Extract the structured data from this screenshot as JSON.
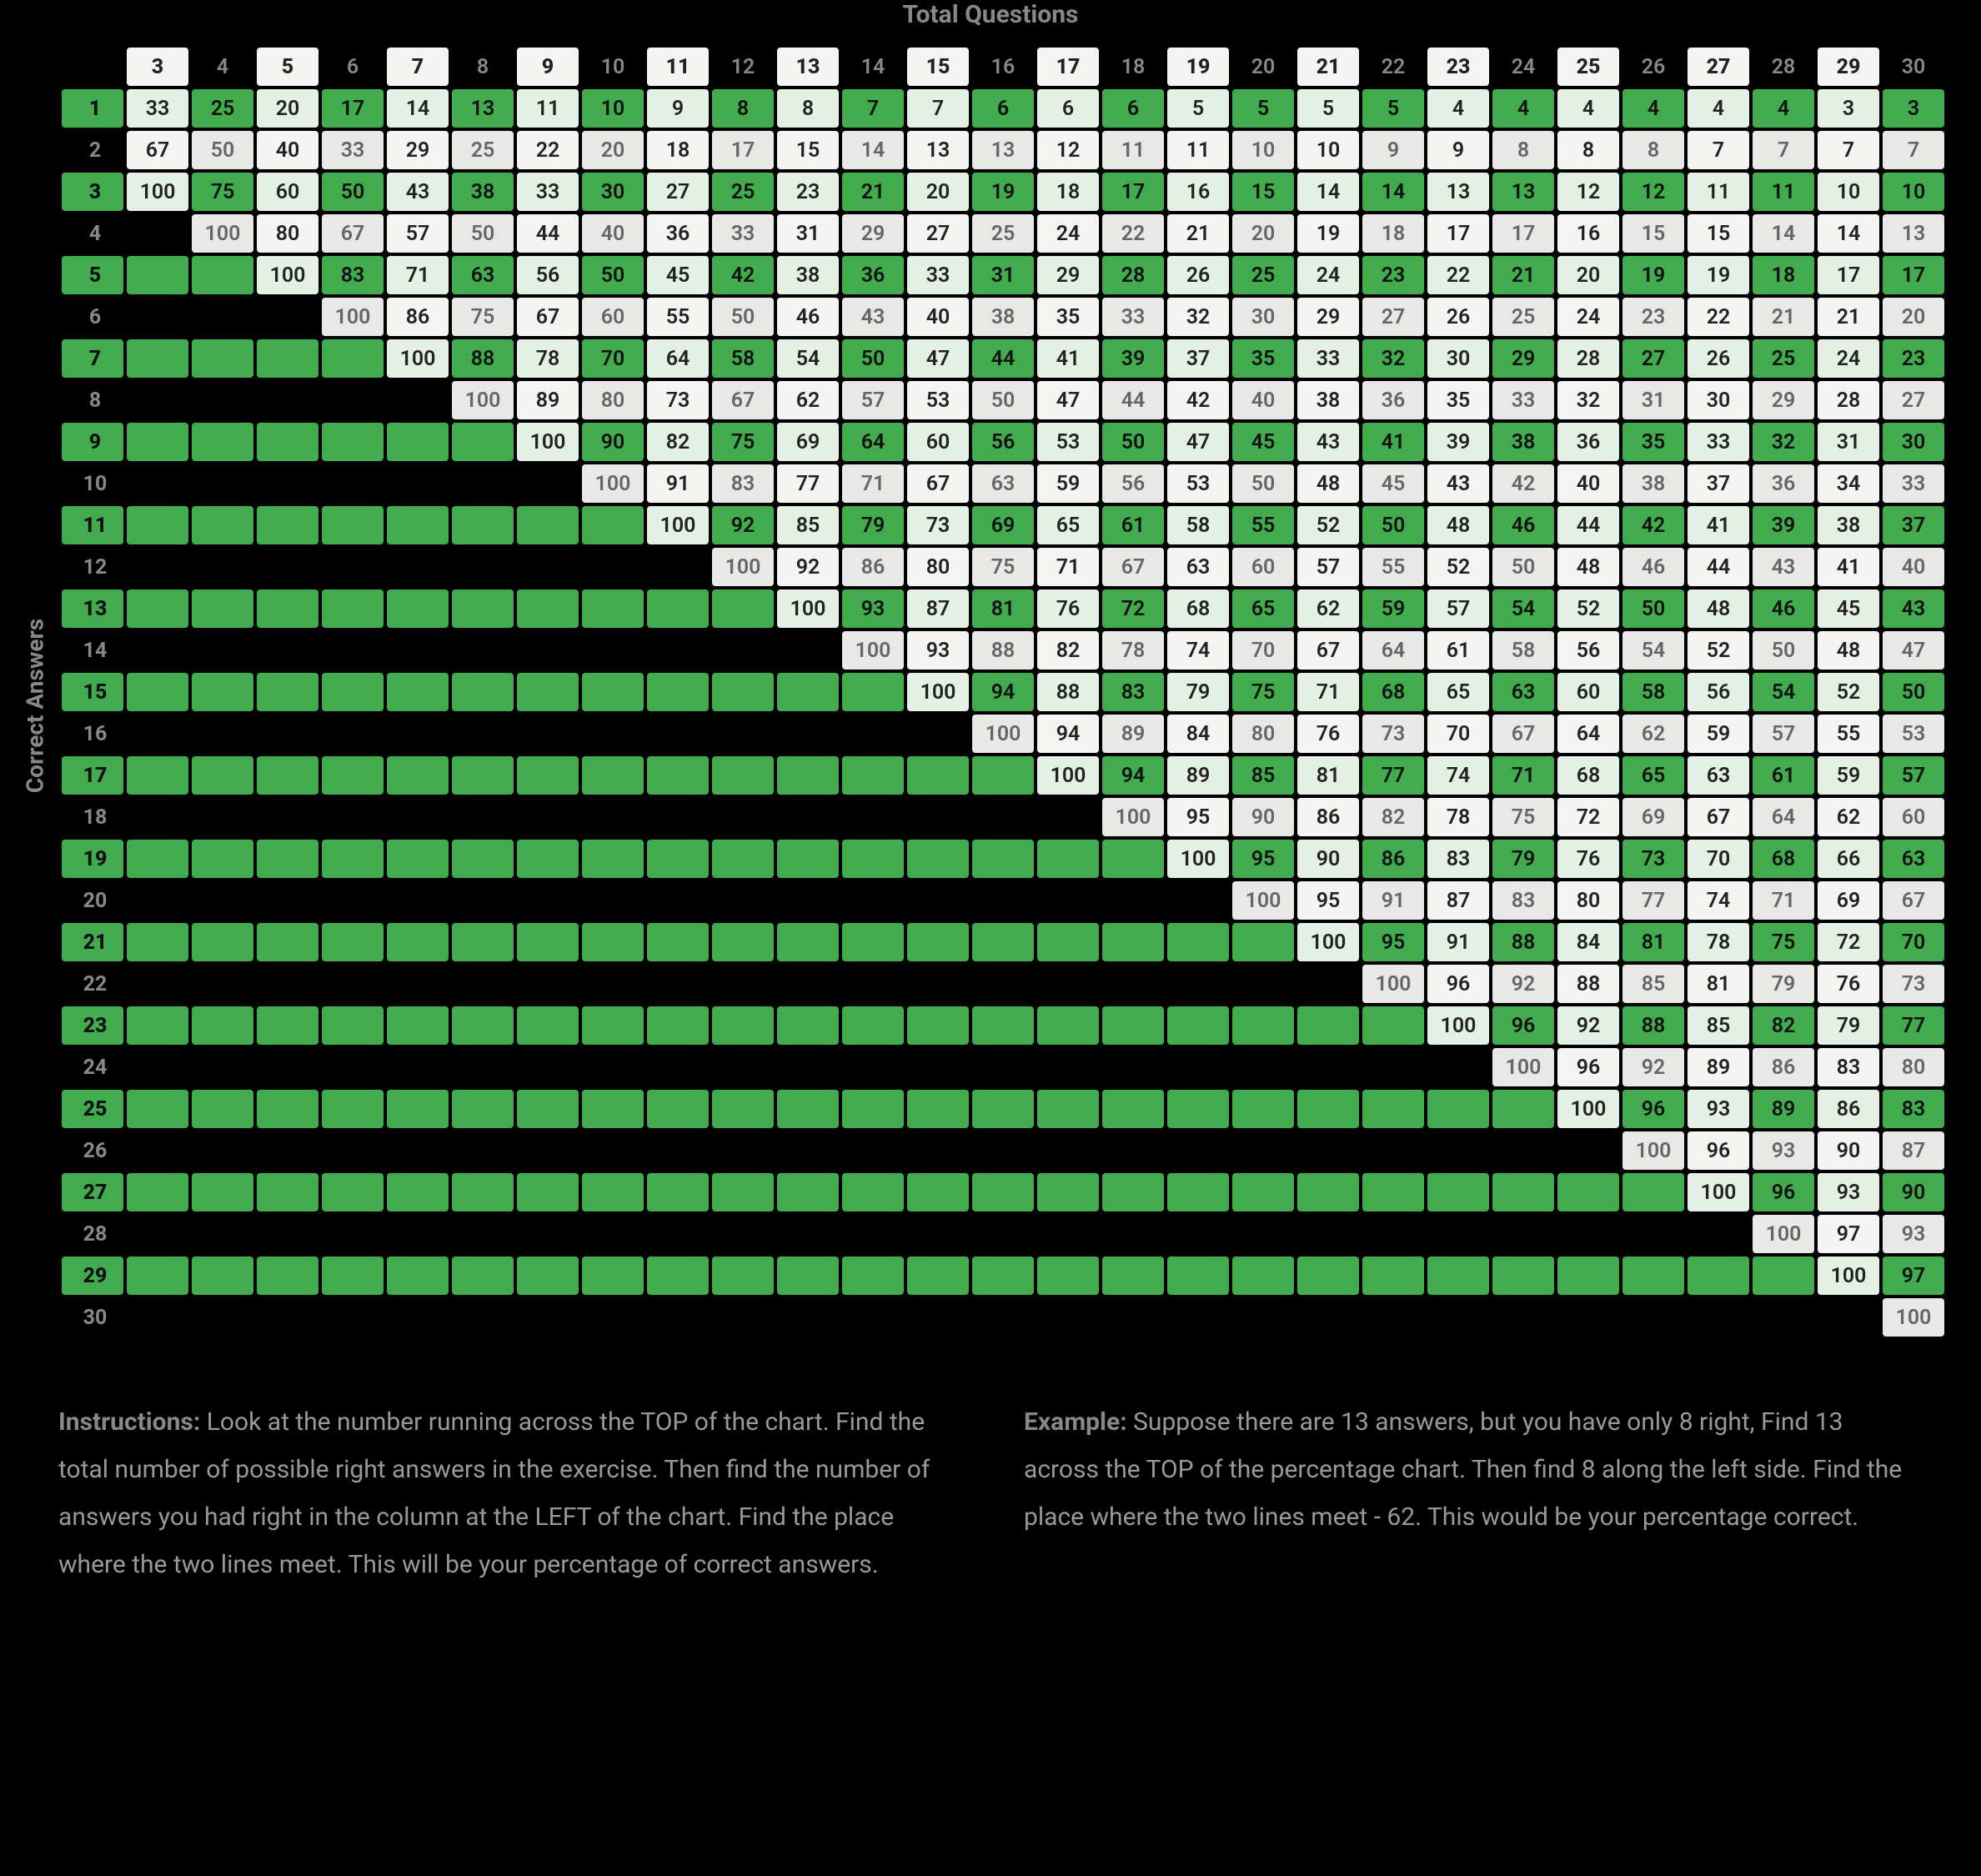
{
  "titles": {
    "top": "Total Questions",
    "side": "Correct Answers"
  },
  "columns": [
    3,
    4,
    5,
    6,
    7,
    8,
    9,
    10,
    11,
    12,
    13,
    14,
    15,
    16,
    17,
    18,
    19,
    20,
    21,
    22,
    23,
    24,
    25,
    26,
    27,
    28,
    29,
    30
  ],
  "rows": [
    1,
    2,
    3,
    4,
    5,
    6,
    7,
    8,
    9,
    10,
    11,
    12,
    13,
    14,
    15,
    16,
    17,
    18,
    19,
    20,
    21,
    22,
    23,
    24,
    25,
    26,
    27,
    28,
    29,
    30
  ],
  "chart_data": {
    "type": "table",
    "title": "Percentage correct lookup table",
    "xlabel": "Total Questions",
    "ylabel": "Correct Answers",
    "columns": [
      3,
      4,
      5,
      6,
      7,
      8,
      9,
      10,
      11,
      12,
      13,
      14,
      15,
      16,
      17,
      18,
      19,
      20,
      21,
      22,
      23,
      24,
      25,
      26,
      27,
      28,
      29,
      30
    ],
    "rows_index": [
      1,
      2,
      3,
      4,
      5,
      6,
      7,
      8,
      9,
      10,
      11,
      12,
      13,
      14,
      15,
      16,
      17,
      18,
      19,
      20,
      21,
      22,
      23,
      24,
      25,
      26,
      27,
      28,
      29,
      30
    ],
    "values": [
      [
        33,
        25,
        20,
        17,
        14,
        13,
        11,
        10,
        9,
        8,
        8,
        7,
        7,
        6,
        6,
        6,
        5,
        5,
        5,
        5,
        4,
        4,
        4,
        4,
        4,
        4,
        3,
        3
      ],
      [
        67,
        50,
        40,
        33,
        29,
        25,
        22,
        20,
        18,
        17,
        15,
        14,
        13,
        13,
        12,
        11,
        11,
        10,
        10,
        9,
        9,
        8,
        8,
        8,
        7,
        7,
        7,
        7
      ],
      [
        100,
        75,
        60,
        50,
        43,
        38,
        33,
        30,
        27,
        25,
        23,
        21,
        20,
        19,
        18,
        17,
        16,
        15,
        14,
        14,
        13,
        13,
        12,
        12,
        11,
        11,
        10,
        10
      ],
      [
        null,
        100,
        80,
        67,
        57,
        50,
        44,
        40,
        36,
        33,
        31,
        29,
        27,
        25,
        24,
        22,
        21,
        20,
        19,
        18,
        17,
        17,
        16,
        15,
        15,
        14,
        14,
        13
      ],
      [
        null,
        null,
        100,
        83,
        71,
        63,
        56,
        50,
        45,
        42,
        38,
        36,
        33,
        31,
        29,
        28,
        26,
        25,
        24,
        23,
        22,
        21,
        20,
        19,
        19,
        18,
        17,
        17
      ],
      [
        null,
        null,
        null,
        100,
        86,
        75,
        67,
        60,
        55,
        50,
        46,
        43,
        40,
        38,
        35,
        33,
        32,
        30,
        29,
        27,
        26,
        25,
        24,
        23,
        22,
        21,
        21,
        20
      ],
      [
        null,
        null,
        null,
        null,
        100,
        88,
        78,
        70,
        64,
        58,
        54,
        50,
        47,
        44,
        41,
        39,
        37,
        35,
        33,
        32,
        30,
        29,
        28,
        27,
        26,
        25,
        24,
        23
      ],
      [
        null,
        null,
        null,
        null,
        null,
        100,
        89,
        80,
        73,
        67,
        62,
        57,
        53,
        50,
        47,
        44,
        42,
        40,
        38,
        36,
        35,
        33,
        32,
        31,
        30,
        29,
        28,
        27
      ],
      [
        null,
        null,
        null,
        null,
        null,
        null,
        100,
        90,
        82,
        75,
        69,
        64,
        60,
        56,
        53,
        50,
        47,
        45,
        43,
        41,
        39,
        38,
        36,
        35,
        33,
        32,
        31,
        30
      ],
      [
        null,
        null,
        null,
        null,
        null,
        null,
        null,
        100,
        91,
        83,
        77,
        71,
        67,
        63,
        59,
        56,
        53,
        50,
        48,
        45,
        43,
        42,
        40,
        38,
        37,
        36,
        34,
        33
      ],
      [
        null,
        null,
        null,
        null,
        null,
        null,
        null,
        null,
        100,
        92,
        85,
        79,
        73,
        69,
        65,
        61,
        58,
        55,
        52,
        50,
        48,
        46,
        44,
        42,
        41,
        39,
        38,
        37
      ],
      [
        null,
        null,
        null,
        null,
        null,
        null,
        null,
        null,
        null,
        100,
        92,
        86,
        80,
        75,
        71,
        67,
        63,
        60,
        57,
        55,
        52,
        50,
        48,
        46,
        44,
        43,
        41,
        40
      ],
      [
        null,
        null,
        null,
        null,
        null,
        null,
        null,
        null,
        null,
        null,
        100,
        93,
        87,
        81,
        76,
        72,
        68,
        65,
        62,
        59,
        57,
        54,
        52,
        50,
        48,
        46,
        45,
        43
      ],
      [
        null,
        null,
        null,
        null,
        null,
        null,
        null,
        null,
        null,
        null,
        null,
        100,
        93,
        88,
        82,
        78,
        74,
        70,
        67,
        64,
        61,
        58,
        56,
        54,
        52,
        50,
        48,
        47
      ],
      [
        null,
        null,
        null,
        null,
        null,
        null,
        null,
        null,
        null,
        null,
        null,
        null,
        100,
        94,
        88,
        83,
        79,
        75,
        71,
        68,
        65,
        63,
        60,
        58,
        56,
        54,
        52,
        50
      ],
      [
        null,
        null,
        null,
        null,
        null,
        null,
        null,
        null,
        null,
        null,
        null,
        null,
        null,
        100,
        94,
        89,
        84,
        80,
        76,
        73,
        70,
        67,
        64,
        62,
        59,
        57,
        55,
        53
      ],
      [
        null,
        null,
        null,
        null,
        null,
        null,
        null,
        null,
        null,
        null,
        null,
        null,
        null,
        null,
        100,
        94,
        89,
        85,
        81,
        77,
        74,
        71,
        68,
        65,
        63,
        61,
        59,
        57
      ],
      [
        null,
        null,
        null,
        null,
        null,
        null,
        null,
        null,
        null,
        null,
        null,
        null,
        null,
        null,
        null,
        100,
        95,
        90,
        86,
        82,
        78,
        75,
        72,
        69,
        67,
        64,
        62,
        60
      ],
      [
        null,
        null,
        null,
        null,
        null,
        null,
        null,
        null,
        null,
        null,
        null,
        null,
        null,
        null,
        null,
        null,
        100,
        95,
        90,
        86,
        83,
        79,
        76,
        73,
        70,
        68,
        66,
        63
      ],
      [
        null,
        null,
        null,
        null,
        null,
        null,
        null,
        null,
        null,
        null,
        null,
        null,
        null,
        null,
        null,
        null,
        null,
        100,
        95,
        91,
        87,
        83,
        80,
        77,
        74,
        71,
        69,
        67
      ],
      [
        null,
        null,
        null,
        null,
        null,
        null,
        null,
        null,
        null,
        null,
        null,
        null,
        null,
        null,
        null,
        null,
        null,
        null,
        100,
        95,
        91,
        88,
        84,
        81,
        78,
        75,
        72,
        70
      ],
      [
        null,
        null,
        null,
        null,
        null,
        null,
        null,
        null,
        null,
        null,
        null,
        null,
        null,
        null,
        null,
        null,
        null,
        null,
        null,
        100,
        96,
        92,
        88,
        85,
        81,
        79,
        76,
        73
      ],
      [
        null,
        null,
        null,
        null,
        null,
        null,
        null,
        null,
        null,
        null,
        null,
        null,
        null,
        null,
        null,
        null,
        null,
        null,
        null,
        null,
        100,
        96,
        92,
        88,
        85,
        82,
        79,
        77
      ],
      [
        null,
        null,
        null,
        null,
        null,
        null,
        null,
        null,
        null,
        null,
        null,
        null,
        null,
        null,
        null,
        null,
        null,
        null,
        null,
        null,
        null,
        100,
        96,
        92,
        89,
        86,
        83,
        80
      ],
      [
        null,
        null,
        null,
        null,
        null,
        null,
        null,
        null,
        null,
        null,
        null,
        null,
        null,
        null,
        null,
        null,
        null,
        null,
        null,
        null,
        null,
        null,
        100,
        96,
        93,
        89,
        86,
        83
      ],
      [
        null,
        null,
        null,
        null,
        null,
        null,
        null,
        null,
        null,
        null,
        null,
        null,
        null,
        null,
        null,
        null,
        null,
        null,
        null,
        null,
        null,
        null,
        null,
        100,
        96,
        93,
        90,
        87
      ],
      [
        null,
        null,
        null,
        null,
        null,
        null,
        null,
        null,
        null,
        null,
        null,
        null,
        null,
        null,
        null,
        null,
        null,
        null,
        null,
        null,
        null,
        null,
        null,
        null,
        100,
        96,
        93,
        90
      ],
      [
        null,
        null,
        null,
        null,
        null,
        null,
        null,
        null,
        null,
        null,
        null,
        null,
        null,
        null,
        null,
        null,
        null,
        null,
        null,
        null,
        null,
        null,
        null,
        null,
        null,
        100,
        97,
        93
      ],
      [
        null,
        null,
        null,
        null,
        null,
        null,
        null,
        null,
        null,
        null,
        null,
        null,
        null,
        null,
        null,
        null,
        null,
        null,
        null,
        null,
        null,
        null,
        null,
        null,
        null,
        null,
        100,
        97
      ],
      [
        null,
        null,
        null,
        null,
        null,
        null,
        null,
        null,
        null,
        null,
        null,
        null,
        null,
        null,
        null,
        null,
        null,
        null,
        null,
        null,
        null,
        null,
        null,
        null,
        null,
        null,
        null,
        100
      ]
    ]
  },
  "text": {
    "instructions_label": "Instructions:",
    "instructions_body": " Look at the number running across the TOP of the chart. Find the total number of possible right answers in the exercise. Then find the number of answers you had right in the column at the LEFT of the chart. Find the place where the two lines meet. This will be your percentage of correct answers.",
    "example_label": "Example:",
    "example_body": " Suppose there are 13 answers, but you have only 8 right, Find 13 across the TOP of the percentage chart. Then find 8 along the left side. Find the place where the two lines meet - 62. This would be your percentage correct."
  }
}
